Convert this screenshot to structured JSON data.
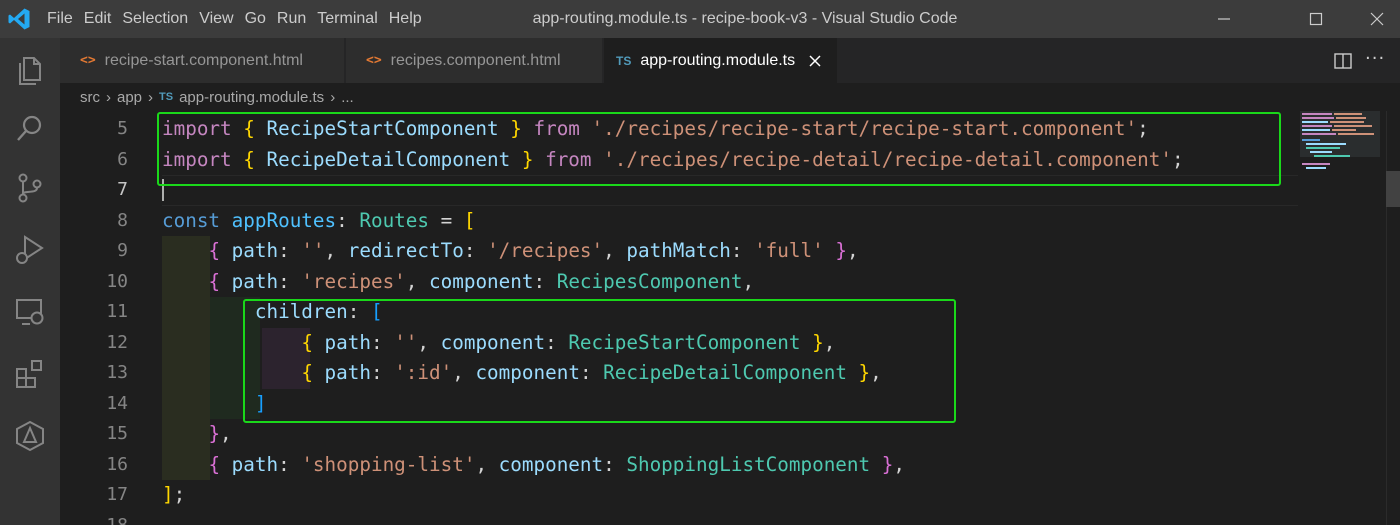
{
  "titlebar": {
    "menu": [
      "File",
      "Edit",
      "Selection",
      "View",
      "Go",
      "Run",
      "Terminal",
      "Help"
    ],
    "title": "app-routing.module.ts - recipe-book-v3 - Visual Studio Code"
  },
  "tabs": [
    {
      "icon": "<>",
      "label": "recipe-start.component.html"
    },
    {
      "icon": "<>",
      "label": "recipes.component.html"
    },
    {
      "icon": "TS",
      "label": "app-routing.module.ts"
    }
  ],
  "breadcrumb": {
    "items": [
      "src",
      "app"
    ],
    "file_icon": "TS",
    "file": "app-routing.module.ts",
    "more": "..."
  },
  "editor": {
    "line_numbers": [
      "5",
      "6",
      "7",
      "8",
      "9",
      "10",
      "11",
      "12",
      "13",
      "14",
      "15",
      "16",
      "17",
      "18"
    ],
    "current_line": "7"
  },
  "colors": {
    "highlight_box": "#1ad81a",
    "accent": "#007acc"
  }
}
